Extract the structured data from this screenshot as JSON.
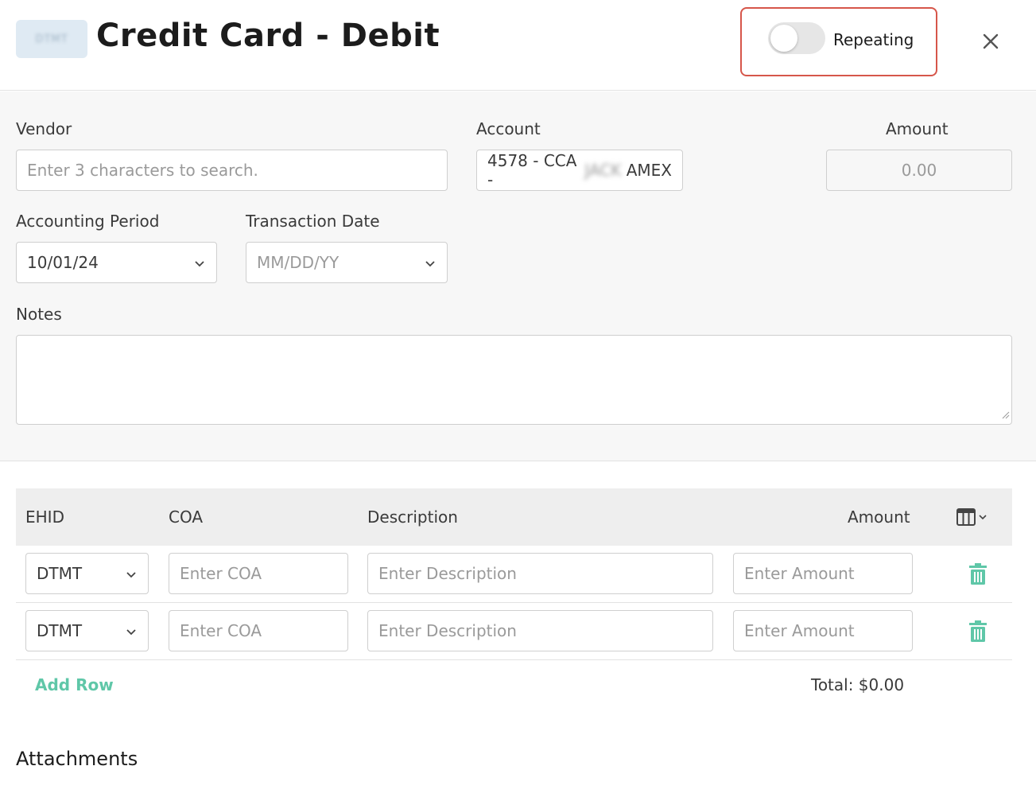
{
  "header": {
    "entity_badge": "DTMT",
    "title": "Credit Card - Debit",
    "repeating_label": "Repeating",
    "repeating_enabled": false,
    "close_icon": "close-icon"
  },
  "form": {
    "vendor_label": "Vendor",
    "vendor_placeholder": "Enter 3 characters to search.",
    "account_label": "Account",
    "account_prefix": "4578 - CCA -",
    "account_redacted": "JACK",
    "account_suffix": "AMEX",
    "amount_label": "Amount",
    "amount_value": "0.00",
    "period_label": "Accounting Period",
    "period_value": "10/01/24",
    "txn_date_label": "Transaction Date",
    "txn_date_placeholder": "MM/DD/YY",
    "notes_label": "Notes"
  },
  "table": {
    "headers": {
      "ehid": "EHID",
      "coa": "COA",
      "description": "Description",
      "amount": "Amount"
    },
    "rows": [
      {
        "ehid": "DTMT",
        "coa_placeholder": "Enter COA",
        "description_placeholder": "Enter Description",
        "amount_placeholder": "Enter Amount"
      },
      {
        "ehid": "DTMT",
        "coa_placeholder": "Enter COA",
        "description_placeholder": "Enter Description",
        "amount_placeholder": "Enter Amount"
      }
    ],
    "add_row_label": "Add Row",
    "total_label": "Total: $0.00"
  },
  "attachments_label": "Attachments",
  "colors": {
    "accent_green": "#5fc7a8",
    "highlight_red": "#d6564a"
  }
}
